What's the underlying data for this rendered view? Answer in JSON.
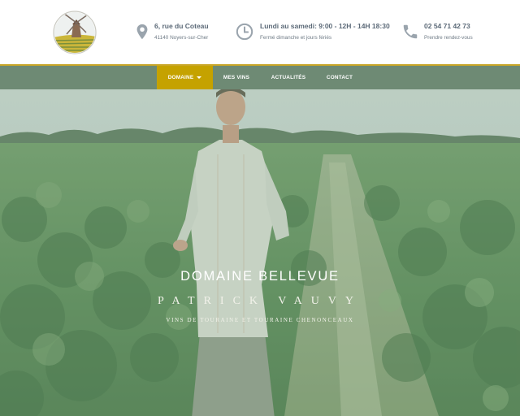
{
  "header": {
    "address": {
      "line1": "6, rue du Coteau",
      "line2": "41140 Noyers-sur-Cher",
      "icon": "map-marker-icon"
    },
    "hours": {
      "line1": "Lundi au samedi: 9:00 - 12H - 14H 18:30",
      "line2": "Fermé dimanche et jours fériés",
      "icon": "clock-icon"
    },
    "phone": {
      "line1": "02 54 71 42 73",
      "line2": "Prendre rendez-vous",
      "icon": "phone-icon"
    }
  },
  "nav": {
    "items": [
      {
        "label": "DOMAINE",
        "active": true,
        "dropdown": true
      },
      {
        "label": "MES VINS"
      },
      {
        "label": "ACTUALITÉS"
      },
      {
        "label": "CONTACT"
      }
    ]
  },
  "hero": {
    "title": "DOMAINE BELLEVUE",
    "name": "PATRICK VAUVY",
    "subtitle": "VINS DE TOURAINE ET TOURAINE CHENONCEAUX"
  },
  "colors": {
    "accent_gold": "#c5a200",
    "nav_green": "#6e8a74",
    "icon_gray": "#9aa4ad"
  }
}
